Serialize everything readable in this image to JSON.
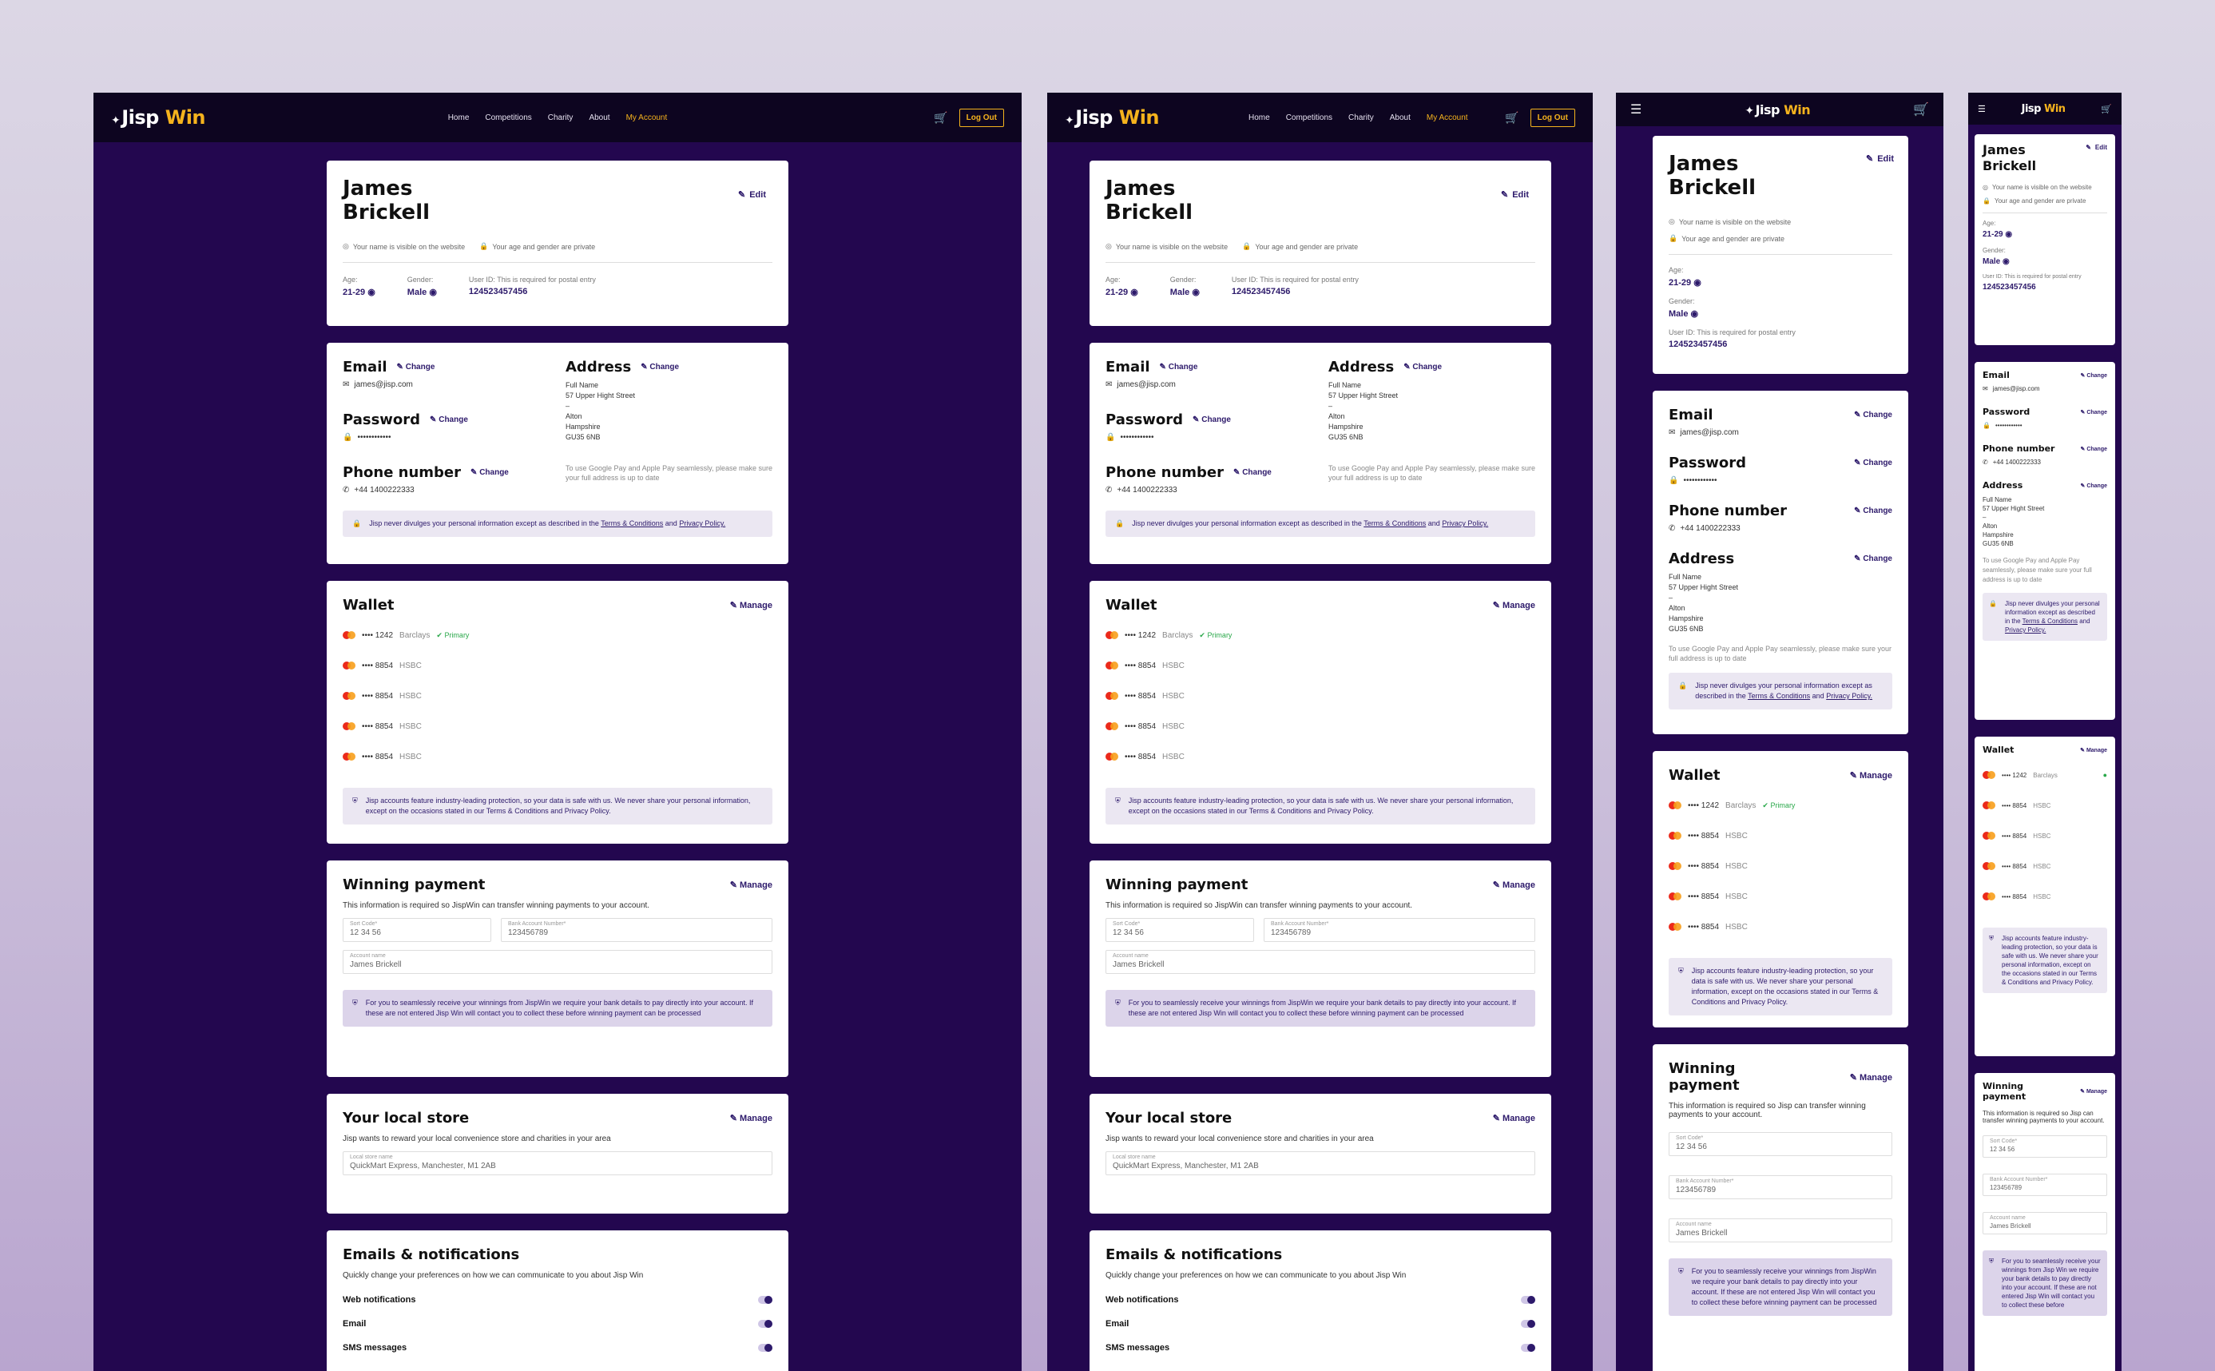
{
  "nav": {
    "logo_a": "Jisp",
    "logo_b": "Win",
    "links": [
      "Home",
      "Competitions",
      "Charity",
      "About",
      "My Account"
    ],
    "logout": "Log Out"
  },
  "profile": {
    "first": "James",
    "last": "Brickell",
    "edit": "Edit",
    "visible": "Your name is visible on the website",
    "private": "Your age and gender are private",
    "age_label": "Age:",
    "age": "21-29",
    "gender_label": "Gender:",
    "gender": "Male",
    "uid_label": "User ID: This is required for postal entry",
    "uid": "124523457456"
  },
  "contact": {
    "email_h": "Email",
    "email": "james@jisp.com",
    "password_h": "Password",
    "password": "••••••••••••",
    "phone_h": "Phone number",
    "phone": "+44 1400222333",
    "address_h": "Address",
    "address": [
      "Full Name",
      "57 Upper Hight Street",
      "–",
      "Alton",
      "Hampshire",
      "GU35 6NB"
    ],
    "change": "Change",
    "pay_note": "To use Google Pay and Apple Pay seamlessly, please make sure your full address is up to date",
    "privacy_a": "Jisp never divulges your personal information except as described in the",
    "privacy_terms": "Terms & Conditions",
    "privacy_and": "and",
    "privacy_policy": "Privacy Policy."
  },
  "wallet": {
    "title": "Wallet",
    "manage": "Manage",
    "cards": [
      {
        "num": "•••• 1242",
        "bank": "Barclays",
        "primary": "Primary"
      },
      {
        "num": "•••• 8854",
        "bank": "HSBC",
        "primary": ""
      },
      {
        "num": "•••• 8854",
        "bank": "HSBC",
        "primary": ""
      },
      {
        "num": "•••• 8854",
        "bank": "HSBC",
        "primary": ""
      },
      {
        "num": "•••• 8854",
        "bank": "HSBC",
        "primary": ""
      }
    ],
    "secure": "Jisp accounts feature industry-leading protection, so your data is safe with us. We never share your personal information, except on the occasions stated in our Terms & Conditions and Privacy Policy."
  },
  "winning": {
    "title": "Winning payment",
    "title_m": "Winning payment",
    "manage": "Manage",
    "desc": "This information is required so JispWin can transfer winning payments to your account.",
    "desc_m": "This information is required so Jisp can transfer winning payments to your account.",
    "sort_label": "Sort Code*",
    "sort": "12 34 56",
    "acc_label": "Bank Account Number*",
    "acc": "123456789",
    "name_label": "Account name",
    "name": "James Brickell",
    "warn": "For you to seamlessly receive your winnings from JispWin we require your bank details to pay directly into your account. If these are not entered Jisp Win will contact you to collect these before winning payment can be processed",
    "warn_short": "For you to seamlessly receive your winnings from Jisp Win we require your bank details to pay directly into your account. If these are not entered Jisp Win will contact you to collect these before"
  },
  "store": {
    "title": "Your local store",
    "manage": "Manage",
    "desc": "Jisp wants to reward your local convenience store and charities in your area",
    "label": "Local store name",
    "value": "QuickMart Express, Manchester, M1 2AB"
  },
  "notif": {
    "title": "Emails & notifications",
    "desc": "Quickly change your preferences on how we can communicate to you about Jisp Win",
    "items": [
      "Web notifications",
      "Email",
      "SMS messages"
    ]
  }
}
